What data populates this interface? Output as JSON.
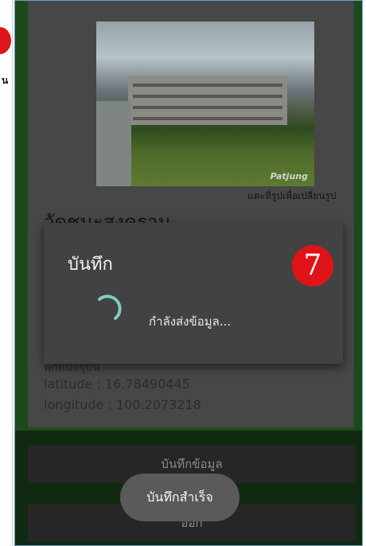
{
  "left_panel": {
    "partial_char": "น"
  },
  "screen": {
    "photo": {
      "watermark": "Patjung"
    },
    "photo_caption": "แตะที่รูปเพื่อเปลี่ยนรูป",
    "place_name": "วัดชนะสงคราม",
    "partial_line": "พิกัดปัจจุบัน",
    "latitude": "latitude : 16.78490445",
    "longitude": "longitude : 100.2073218",
    "save_button_label": "บันทึกข้อมูล",
    "exit_button_label": "ออก"
  },
  "dialog": {
    "title": "บันทึก",
    "message": "กำลังส่งข้อมูล...",
    "step_number": "7",
    "spinner_color": "#80cbc4"
  },
  "toast": {
    "text": "บันทึกสำเร็จ"
  },
  "colors": {
    "frame_green": "#1d4a1d",
    "badge_red": "#e01418",
    "dialog_bg": "#424242"
  }
}
